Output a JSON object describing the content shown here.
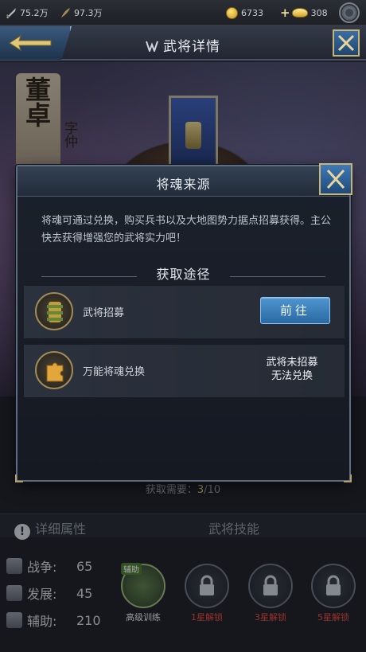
{
  "topbar": {
    "resource1": "75.2万",
    "resource2": "97.3万",
    "copper": "6733",
    "gold": "308"
  },
  "header": {
    "title": "武将详情"
  },
  "hero": {
    "name": "董卓",
    "courtesy": "字仲"
  },
  "progress": {
    "label": "获取需要：",
    "current": "3",
    "total": "/10"
  },
  "tabs": {
    "detail": "详细属性",
    "skills": "武将技能"
  },
  "stats": [
    {
      "label": "战争:",
      "value": "65"
    },
    {
      "label": "发展:",
      "value": "45"
    },
    {
      "label": "辅助:",
      "value": "210"
    }
  ],
  "skills": {
    "badge": "辅助",
    "items": [
      {
        "label": "高级训练"
      },
      {
        "label": "1星解锁"
      },
      {
        "label": "3星解锁"
      },
      {
        "label": "5星解锁"
      }
    ]
  },
  "dialog": {
    "title": "将魂来源",
    "description": "将魂可通过兑换，购买兵书以及大地图势力据点招募获得。主公快去获得增强您的武将实力吧！",
    "section_title": "获取途径",
    "sources": [
      {
        "label": "武将招募",
        "button": "前往"
      },
      {
        "label": "万能将魂兑换",
        "status_line1": "武将未招募",
        "status_line2": "无法兑换"
      }
    ]
  },
  "colors": {
    "accent": "#3f7ab8",
    "gold_frame": "#c8b576",
    "locked_red": "#e24a3a"
  },
  "icons": [
    "sword-icon",
    "quill-icon",
    "copper-coin-icon",
    "gold-ingot-icon",
    "settings-icon",
    "back-arrow-icon",
    "close-icon",
    "scroll-icon",
    "puzzle-soul-icon",
    "lock-icon",
    "info-icon"
  ]
}
